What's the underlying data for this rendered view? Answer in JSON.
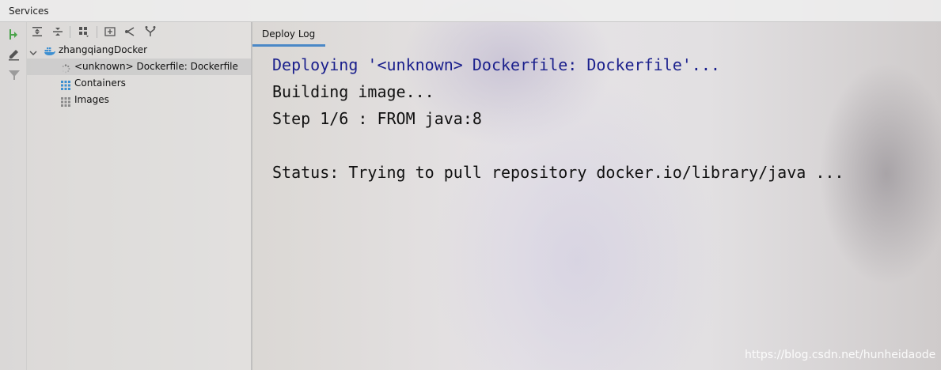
{
  "window": {
    "title": "Services"
  },
  "tree": {
    "root_label": "zhangqiangDocker",
    "items": [
      {
        "label": "<unknown> Dockerfile: Dockerfile"
      },
      {
        "label": "Containers"
      },
      {
        "label": "Images"
      }
    ]
  },
  "tabs": [
    {
      "label": "Deploy Log"
    }
  ],
  "log": {
    "lines": [
      "Deploying '<unknown> Dockerfile: Dockerfile'...",
      "Building image...",
      "Step 1/6 : FROM java:8",
      "Status: Trying to pull repository docker.io/library/java ..."
    ]
  },
  "watermark": "https://blog.csdn.net/hunheidaode",
  "colors": {
    "accent": "#4a88c7",
    "log_info": "#1a1f8c",
    "log_text": "#111111",
    "deploy_icon": "#4aa34a",
    "docker_icon": "#3d8fd1"
  },
  "icons": {
    "left_toolbar": [
      "deploy-icon",
      "edit-icon",
      "filter-icon"
    ],
    "tree_toolbar": [
      "expand-all-icon",
      "collapse-all-icon",
      "group-icon",
      "new-service-icon",
      "connect-icon",
      "split-icon"
    ]
  }
}
